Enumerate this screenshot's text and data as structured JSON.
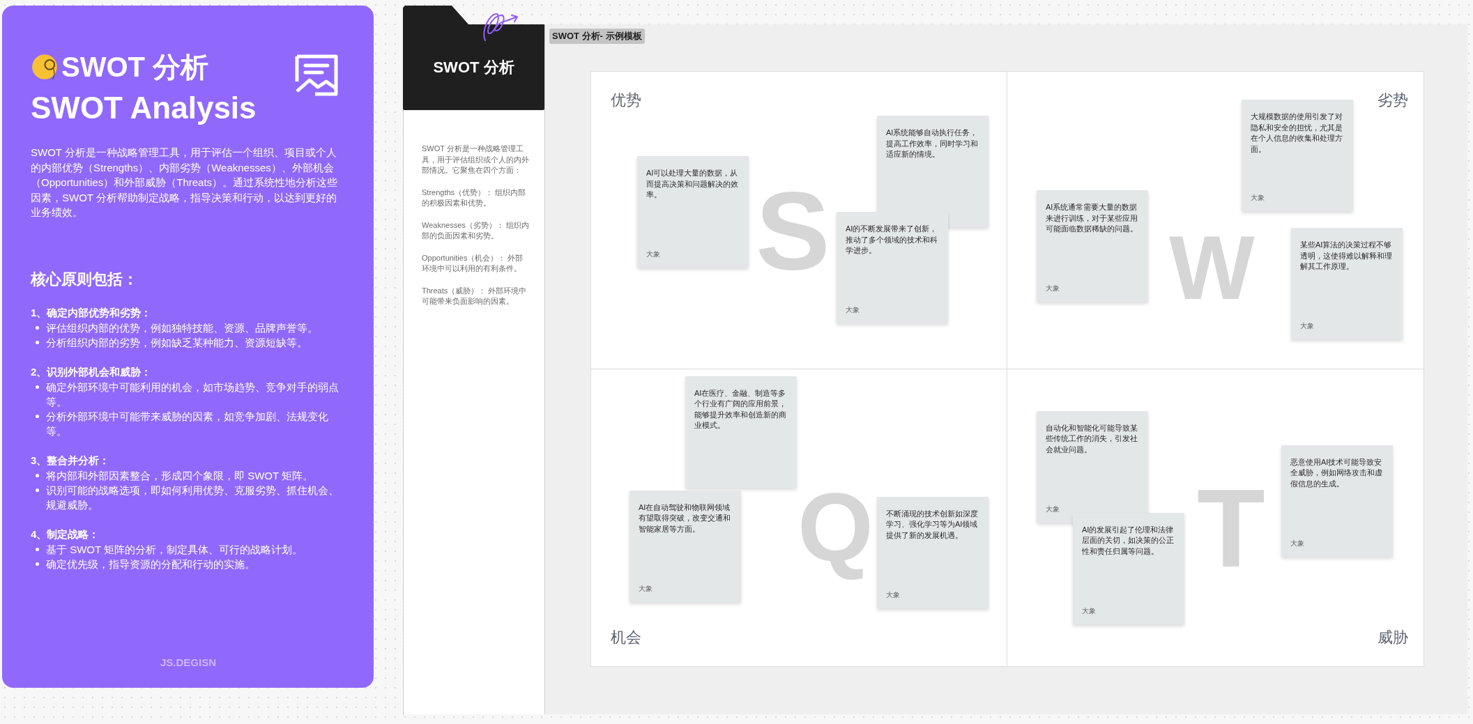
{
  "panel": {
    "title": "SWOT 分析",
    "subtitle": "SWOT Analysis",
    "intro": "SWOT 分析是一种战略管理工具，用于评估一个组织、项目或个人的内部优势（Strengths）、内部劣势（Weaknesses）、外部机会（Opportunities）和外部威胁（Threats）。通过系统性地分析这些因素，SWOT 分析帮助制定战略，指导决策和行动，以达到更好的业务绩效。",
    "principles_heading": "核心原则包括：",
    "principles": [
      {
        "heading": "1、确定内部优势和劣势：",
        "items": [
          "评估组织内部的优势，例如独特技能、资源、品牌声誉等。",
          "分析组织内部的劣势，例如缺乏某种能力、资源短缺等。"
        ]
      },
      {
        "heading": "2、识别外部机会和威胁：",
        "items": [
          "确定外部环境中可能利用的机会，如市场趋势、竞争对手的弱点等。",
          "分析外部环境中可能带来威胁的因素，如竞争加剧、法规变化等。"
        ]
      },
      {
        "heading": "3、整合并分析：",
        "items": [
          "将内部和外部因素整合，形成四个象限，即 SWOT 矩阵。",
          "识别可能的战略选项，即如何利用优势、克服劣势、抓住机会、规避威胁。"
        ]
      },
      {
        "heading": "4、制定战略：",
        "items": [
          "基于 SWOT 矩阵的分析，制定具体、可行的战略计划。",
          "确定优先级，指导资源的分配和行动的实施。"
        ]
      }
    ],
    "footer": "JS.DEGISN"
  },
  "sidebar": {
    "title": "SWOT 分析",
    "paragraphs": [
      "SWOT 分析是一种战略管理工具，用于评估组织或个人的内外部情况。它聚焦在四个方面：",
      "Strengths（优势）： 组织内部的积极因素和优势。",
      "Weaknesses（劣势）： 组织内部的负面因素和劣势。",
      "Opportunities（机会）： 外部环境中可以利用的有利条件。",
      "Threats（威胁）： 外部环境中可能带来负面影响的因素。"
    ]
  },
  "canvas": {
    "label": "SWOT 分析- 示例模板",
    "quadrants": [
      {
        "title": "优势",
        "letter": "S",
        "notes": [
          {
            "text": "AI可以处理大量的数据，从而提高决策和问题解决的效率。",
            "author": "大象"
          },
          {
            "text": "AI系统能够自动执行任务，提高工作效率，同时学习和适应新的情境。"
          },
          {
            "text": "AI的不断发展带来了创新，推动了多个领域的技术和科学进步。",
            "author": "大象"
          }
        ]
      },
      {
        "title": "劣势",
        "letter": "W",
        "notes": [
          {
            "text": "AI系统通常需要大量的数据来进行训练，对于某些应用可能面临数据稀缺的问题。",
            "author": "大象"
          },
          {
            "text": "大规模数据的使用引发了对隐私和安全的担忧，尤其是在个人信息的收集和处理方面。",
            "author": "大象"
          },
          {
            "text": "某些AI算法的决策过程不够透明，这使得难以解释和理解其工作原理。",
            "author": "大象"
          }
        ]
      },
      {
        "title": "机会",
        "letter": "Q",
        "notes": [
          {
            "text": "AI在医疗、金融、制造等多个行业有广阔的应用前景，能够提升效率和创造新的商业模式。"
          },
          {
            "text": " AI在自动驾驶和物联网领域有望取得突破，改变交通和智能家居等方面。",
            "author": "大象"
          },
          {
            "text": "不断涌现的技术创新如深度学习、强化学习等为AI领域提供了新的发展机遇。",
            "author": "大象"
          }
        ]
      },
      {
        "title": "威胁",
        "letter": "T",
        "notes": [
          {
            "text": "自动化和智能化可能导致某些传统工作的消失，引发社会就业问题。",
            "author": "大象"
          },
          {
            "text": "AI的发展引起了伦理和法律层面的关切，如决策的公正性和责任归属等问题。",
            "author": "大象"
          },
          {
            "text": "恶意使用AI技术可能导致安全威胁，例如网络攻击和虚假信息的生成。",
            "author": "大象"
          }
        ]
      }
    ]
  }
}
